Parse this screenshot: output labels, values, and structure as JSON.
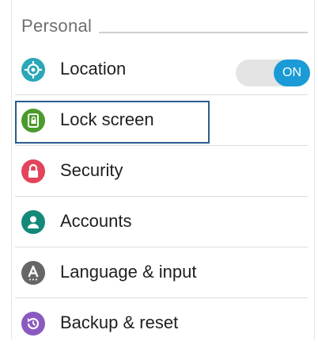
{
  "section": {
    "title": "Personal"
  },
  "items": [
    {
      "label": "Location",
      "icon": "location-icon",
      "color": "#2aa7b8"
    },
    {
      "label": "Lock screen",
      "icon": "lock-screen-icon",
      "color": "#4a9a2c"
    },
    {
      "label": "Security",
      "icon": "security-lock-icon",
      "color": "#e2445c"
    },
    {
      "label": "Accounts",
      "icon": "account-person-icon",
      "color": "#14897a"
    },
    {
      "label": "Language & input",
      "icon": "language-a-icon",
      "color": "#666666"
    },
    {
      "label": "Backup & reset",
      "icon": "backup-restore-icon",
      "color": "#8a5bbf"
    }
  ],
  "location_toggle": {
    "state": "ON",
    "on": true,
    "accent": "#1b9bd6"
  },
  "focus_highlight_color": "#2a5d8f"
}
